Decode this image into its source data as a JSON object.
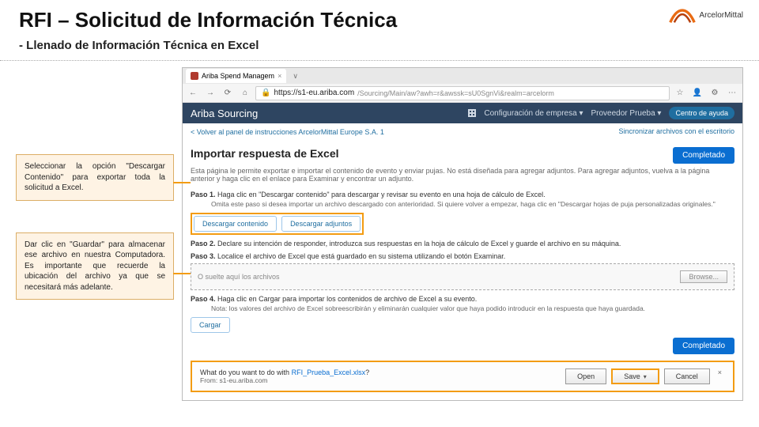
{
  "slide": {
    "title": "RFI – Solicitud de Información Técnica",
    "subtitle": "- Llenado de Información Técnica en Excel"
  },
  "logo": {
    "text": "ArcelorMittal"
  },
  "callouts": [
    "Seleccionar la opción \"Descargar Contenido\" para exportar toda la solicitud a Excel.",
    "Dar clic en \"Guardar\" para almacenar ese archivo en nuestra Computadora. Es importante que recuerde la ubicación del archivo ya que se necesitará más adelante."
  ],
  "browser": {
    "tab": "Ariba Spend Managem",
    "tab_plus": "∨",
    "nav": {
      "back": "←",
      "fwd": "→",
      "reload": "⟳",
      "home": "⌂"
    },
    "lock": "🔒",
    "url_host": "https://s1-eu.ariba.com",
    "url_path": "/Sourcing/Main/aw?awh=r&awssk=sU0SgnVi&realm=arcelorm",
    "star": "☆",
    "menu_icons": [
      "👤",
      "⚙",
      "⋯"
    ]
  },
  "app": {
    "brand": "Ariba Sourcing",
    "config": "Configuración de empresa ▾",
    "provider": "Proveedor Prueba ▾",
    "help": "Centro de ayuda",
    "back_link": "< Volver al panel de instrucciones ArcelorMittal Europe S.A. 1",
    "sync": "Sincronizar archivos con el escritorio",
    "page_title": "Importar respuesta de Excel",
    "complete_btn": "Completado",
    "intro": "Esta página le permite exportar e importar el contenido de evento y enviar pujas. No está diseñada para agregar adjuntos. Para agregar adjuntos, vuelva a la página anterior y haga clic en el enlace para Examinar y encontrar un adjunto.",
    "step1": {
      "label": "Paso 1.",
      "text": "Haga clic en \"Descargar contenido\" para descargar y revisar su evento en una hoja de cálculo de Excel."
    },
    "step1_note": "Omita este paso si desea importar un archivo descargado con anterioridad. Si quiere volver a empezar, haga clic en \"Descargar hojas de puja personalizadas originales.\"",
    "btn_descargar_contenido": "Descargar contenido",
    "btn_descargar_adjuntos": "Descargar adjuntos",
    "step2": {
      "label": "Paso 2.",
      "text": "Declare su intención de responder, introduzca sus respuestas en la hoja de cálculo de Excel y guarde el archivo en su máquina."
    },
    "step3": {
      "label": "Paso 3.",
      "text": "Localice el archivo de Excel que está guardado en su sistema utilizando el botón Examinar."
    },
    "dropzone": "O suelte aquí los archivos",
    "browse": "Browse...",
    "step4": {
      "label": "Paso 4.",
      "text": "Haga clic en Cargar para importar los contenidos de archivo de Excel a su evento."
    },
    "step4_note": "Nota: los valores del archivo de Excel sobreescribirán y eliminarán cualquier valor que haya podido introducir en la respuesta que haya guardada.",
    "btn_cargar": "Cargar"
  },
  "download": {
    "question": "What do you want to do with ",
    "filename": "RFI_Prueba_Excel.xlsx",
    "from": "From: s1-eu.ariba.com",
    "open": "Open",
    "save": "Save",
    "cancel": "Cancel",
    "close_x": "×"
  }
}
